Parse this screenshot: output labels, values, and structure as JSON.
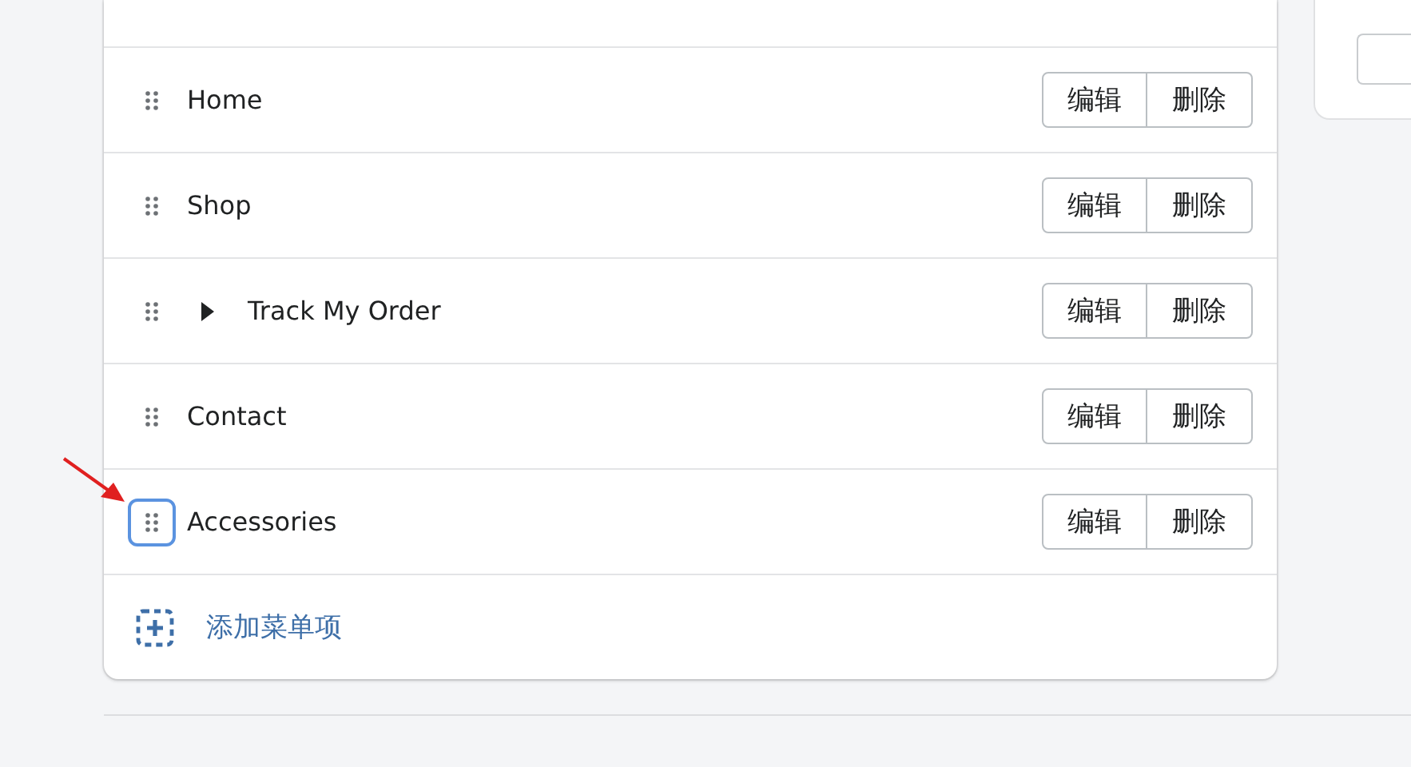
{
  "menu_items": [
    {
      "label": "Home",
      "focused": false,
      "buttons": [
        "编辑",
        "删除"
      ]
    },
    {
      "label": "Shop",
      "focused": false,
      "buttons": [
        "编辑",
        "删除"
      ]
    },
    {
      "label": "Track My Order",
      "expanded": false,
      "focused": false,
      "buttons": [
        "编辑",
        "删除"
      ]
    },
    {
      "label": "Contact",
      "focused": false,
      "buttons": [
        "编辑",
        "删除"
      ]
    },
    {
      "label": "Accessories",
      "focused": true,
      "buttons": [
        "编辑",
        "删除"
      ]
    }
  ],
  "add_item": {
    "label": "添加菜单项"
  }
}
